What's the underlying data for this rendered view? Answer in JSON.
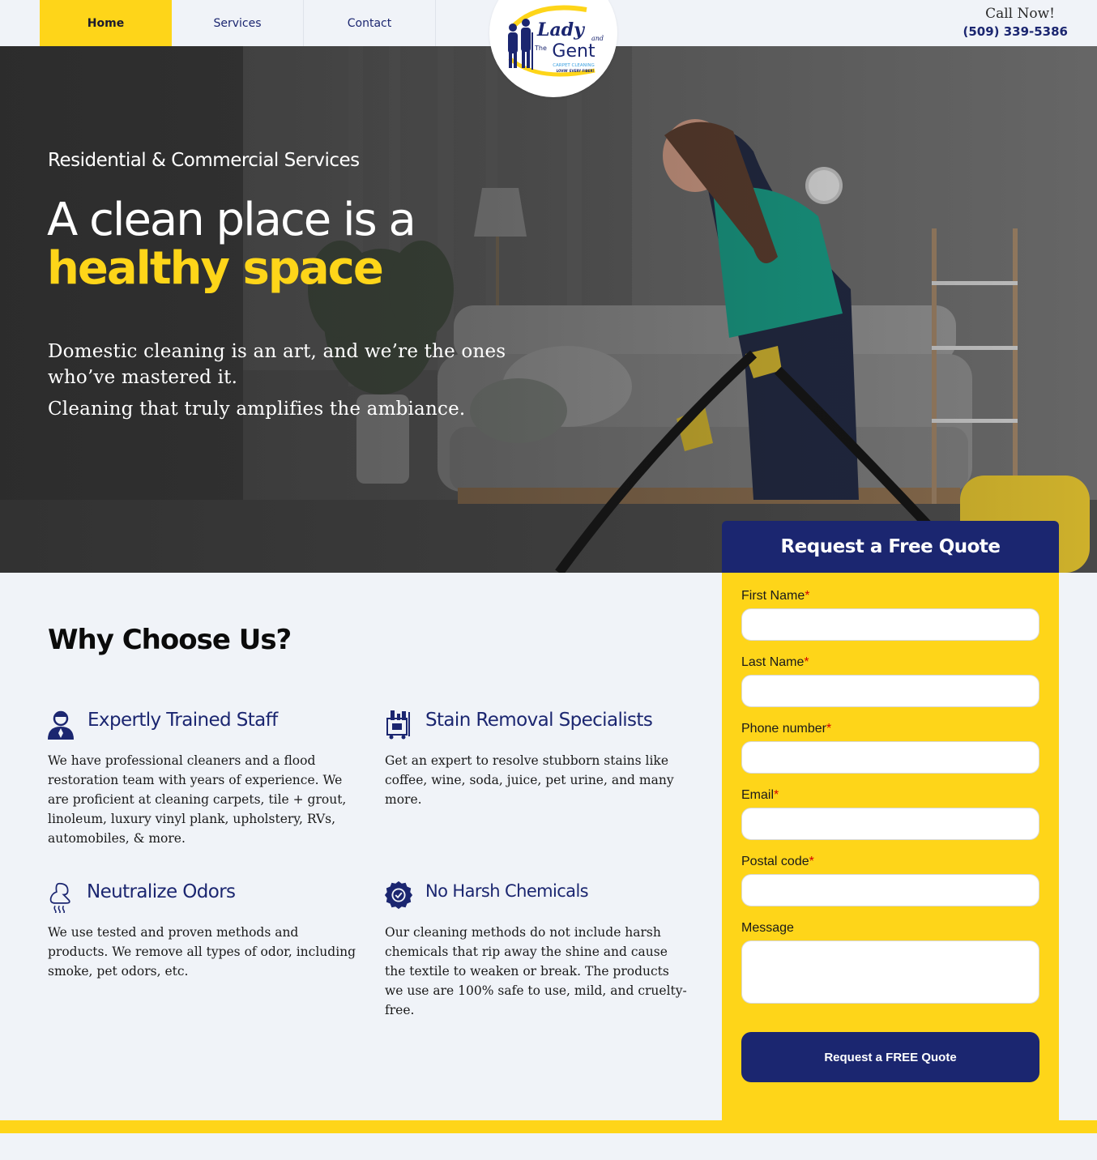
{
  "nav": {
    "items": [
      {
        "label": "Home",
        "active": true
      },
      {
        "label": "Services"
      },
      {
        "label": "Contact"
      }
    ]
  },
  "header": {
    "call_label": "Call Now!",
    "phone": "(509) 339-5386"
  },
  "logo": {
    "word1": "Lady",
    "word_and": "and",
    "word_the": "The",
    "word2": "Gent",
    "tagline": "CARPET CLEANING",
    "slogan": "LOVIN' EVERY FIBER!"
  },
  "hero": {
    "eyebrow": "Residential & Commercial Services",
    "title_line1": "A clean place is a",
    "title_line2": "healthy space",
    "text1": "Domestic cleaning is an art, and we’re the ones who’ve mastered it.",
    "text2": "Cleaning that truly amplifies the ambiance."
  },
  "why": {
    "title": "Why Choose Us?",
    "features": [
      {
        "icon": "staff-icon",
        "title": "Expertly Trained Staff",
        "body": "We have professional cleaners and a flood restoration team with years of experience. We are proficient at cleaning carpets, tile + grout, linoleum, luxury vinyl plank, upholstery, RVs, automobiles, & more."
      },
      {
        "icon": "cleaning-cart-icon",
        "title": "Stain Removal Specialists",
        "body": "Get an expert to resolve stubborn stains like coffee, wine, soda, juice, pet urine, and many more."
      },
      {
        "icon": "nose-odor-icon",
        "title": "Neutralize Odors",
        "body": "We use tested and proven methods and products. We remove all types of odor, including smoke, pet odors, etc."
      },
      {
        "icon": "badge-check-icon",
        "title": "No Harsh Chemicals",
        "body": "Our cleaning methods do not include harsh chemicals that rip away the shine and cause the textile to weaken or break. The products we use are 100% safe to use, mild, and cruelty-free."
      }
    ]
  },
  "form": {
    "title": "Request a Free Quote",
    "fields": [
      {
        "label": "First Name",
        "required": "*",
        "value": ""
      },
      {
        "label": "Last Name",
        "required": "*",
        "value": ""
      },
      {
        "label": "Phone number",
        "required": "*",
        "value": ""
      },
      {
        "label": "Email",
        "required": "*",
        "value": ""
      },
      {
        "label": "Postal code",
        "required": "*",
        "value": ""
      },
      {
        "label": "Message",
        "required": "",
        "value": ""
      }
    ],
    "submit_label": "Request a FREE Quote"
  },
  "colors": {
    "brand_navy": "#1b2670",
    "brand_yellow": "#fed519",
    "page_bg": "#f0f3f8"
  }
}
